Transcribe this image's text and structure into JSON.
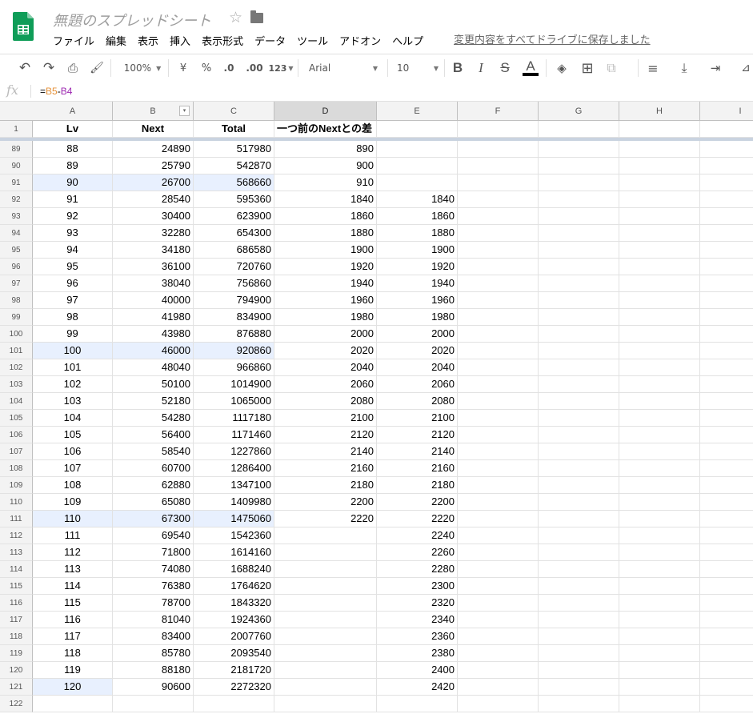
{
  "app": {
    "title": "無題のスプレッドシート",
    "saved_status": "変更内容をすべてドライブに保存しました"
  },
  "menu": [
    "ファイル",
    "編集",
    "表示",
    "挿入",
    "表示形式",
    "データ",
    "ツール",
    "アドオン",
    "ヘルプ"
  ],
  "toolbar": {
    "zoom": "100%",
    "currency": "¥",
    "percent": "%",
    "dec_less": ".0",
    "dec_more": ".00",
    "more_formats": "123",
    "font": "Arial",
    "font_size": "10"
  },
  "formula_bar": {
    "fx": "fx",
    "eq": "=",
    "ref1": "B5",
    "op": "-",
    "ref2": "B4"
  },
  "columns": [
    "A",
    "B",
    "C",
    "D",
    "E",
    "F",
    "G",
    "H",
    "I"
  ],
  "header_row": {
    "num": "1",
    "cells": [
      "Lv",
      "Next",
      "Total",
      "一つ前のNextとの差",
      "",
      "",
      "",
      "",
      ""
    ]
  },
  "rows": [
    {
      "num": "89",
      "cells": [
        "88",
        "24890",
        "517980",
        "890",
        ""
      ]
    },
    {
      "num": "90",
      "cells": [
        "89",
        "25790",
        "542870",
        "900",
        ""
      ]
    },
    {
      "num": "91",
      "cells": [
        "90",
        "26700",
        "568660",
        "910",
        ""
      ]
    },
    {
      "num": "92",
      "cells": [
        "91",
        "28540",
        "595360",
        "1840",
        "1840"
      ]
    },
    {
      "num": "93",
      "cells": [
        "92",
        "30400",
        "623900",
        "1860",
        "1860"
      ]
    },
    {
      "num": "94",
      "cells": [
        "93",
        "32280",
        "654300",
        "1880",
        "1880"
      ]
    },
    {
      "num": "95",
      "cells": [
        "94",
        "34180",
        "686580",
        "1900",
        "1900"
      ]
    },
    {
      "num": "96",
      "cells": [
        "95",
        "36100",
        "720760",
        "1920",
        "1920"
      ]
    },
    {
      "num": "97",
      "cells": [
        "96",
        "38040",
        "756860",
        "1940",
        "1940"
      ]
    },
    {
      "num": "98",
      "cells": [
        "97",
        "40000",
        "794900",
        "1960",
        "1960"
      ]
    },
    {
      "num": "99",
      "cells": [
        "98",
        "41980",
        "834900",
        "1980",
        "1980"
      ]
    },
    {
      "num": "100",
      "cells": [
        "99",
        "43980",
        "876880",
        "2000",
        "2000"
      ]
    },
    {
      "num": "101",
      "cells": [
        "100",
        "46000",
        "920860",
        "2020",
        "2020"
      ]
    },
    {
      "num": "102",
      "cells": [
        "101",
        "48040",
        "966860",
        "2040",
        "2040"
      ]
    },
    {
      "num": "103",
      "cells": [
        "102",
        "50100",
        "1014900",
        "2060",
        "2060"
      ]
    },
    {
      "num": "104",
      "cells": [
        "103",
        "52180",
        "1065000",
        "2080",
        "2080"
      ]
    },
    {
      "num": "105",
      "cells": [
        "104",
        "54280",
        "1117180",
        "2100",
        "2100"
      ]
    },
    {
      "num": "106",
      "cells": [
        "105",
        "56400",
        "1171460",
        "2120",
        "2120"
      ]
    },
    {
      "num": "107",
      "cells": [
        "106",
        "58540",
        "1227860",
        "2140",
        "2140"
      ]
    },
    {
      "num": "108",
      "cells": [
        "107",
        "60700",
        "1286400",
        "2160",
        "2160"
      ]
    },
    {
      "num": "109",
      "cells": [
        "108",
        "62880",
        "1347100",
        "2180",
        "2180"
      ]
    },
    {
      "num": "110",
      "cells": [
        "109",
        "65080",
        "1409980",
        "2200",
        "2200"
      ]
    },
    {
      "num": "111",
      "cells": [
        "110",
        "67300",
        "1475060",
        "2220",
        "2220"
      ]
    },
    {
      "num": "112",
      "cells": [
        "111",
        "69540",
        "1542360",
        "",
        "2240"
      ]
    },
    {
      "num": "113",
      "cells": [
        "112",
        "71800",
        "1614160",
        "",
        "2260"
      ]
    },
    {
      "num": "114",
      "cells": [
        "113",
        "74080",
        "1688240",
        "",
        "2280"
      ]
    },
    {
      "num": "115",
      "cells": [
        "114",
        "76380",
        "1764620",
        "",
        "2300"
      ]
    },
    {
      "num": "116",
      "cells": [
        "115",
        "78700",
        "1843320",
        "",
        "2320"
      ]
    },
    {
      "num": "117",
      "cells": [
        "116",
        "81040",
        "1924360",
        "",
        "2340"
      ]
    },
    {
      "num": "118",
      "cells": [
        "117",
        "83400",
        "2007760",
        "",
        "2360"
      ]
    },
    {
      "num": "119",
      "cells": [
        "118",
        "85780",
        "2093540",
        "",
        "2380"
      ]
    },
    {
      "num": "120",
      "cells": [
        "119",
        "88180",
        "2181720",
        "",
        "2400"
      ]
    },
    {
      "num": "121",
      "cells": [
        "120",
        "90600",
        "2272320",
        "",
        "2420"
      ]
    },
    {
      "num": "122",
      "cells": [
        "",
        "",
        "",
        "",
        ""
      ]
    }
  ],
  "highlights": {
    "rows_A_to_C": [
      "91",
      "101",
      "111"
    ],
    "rows_A_only": [
      "121"
    ],
    "highlight_color": "#e8f0fe"
  }
}
